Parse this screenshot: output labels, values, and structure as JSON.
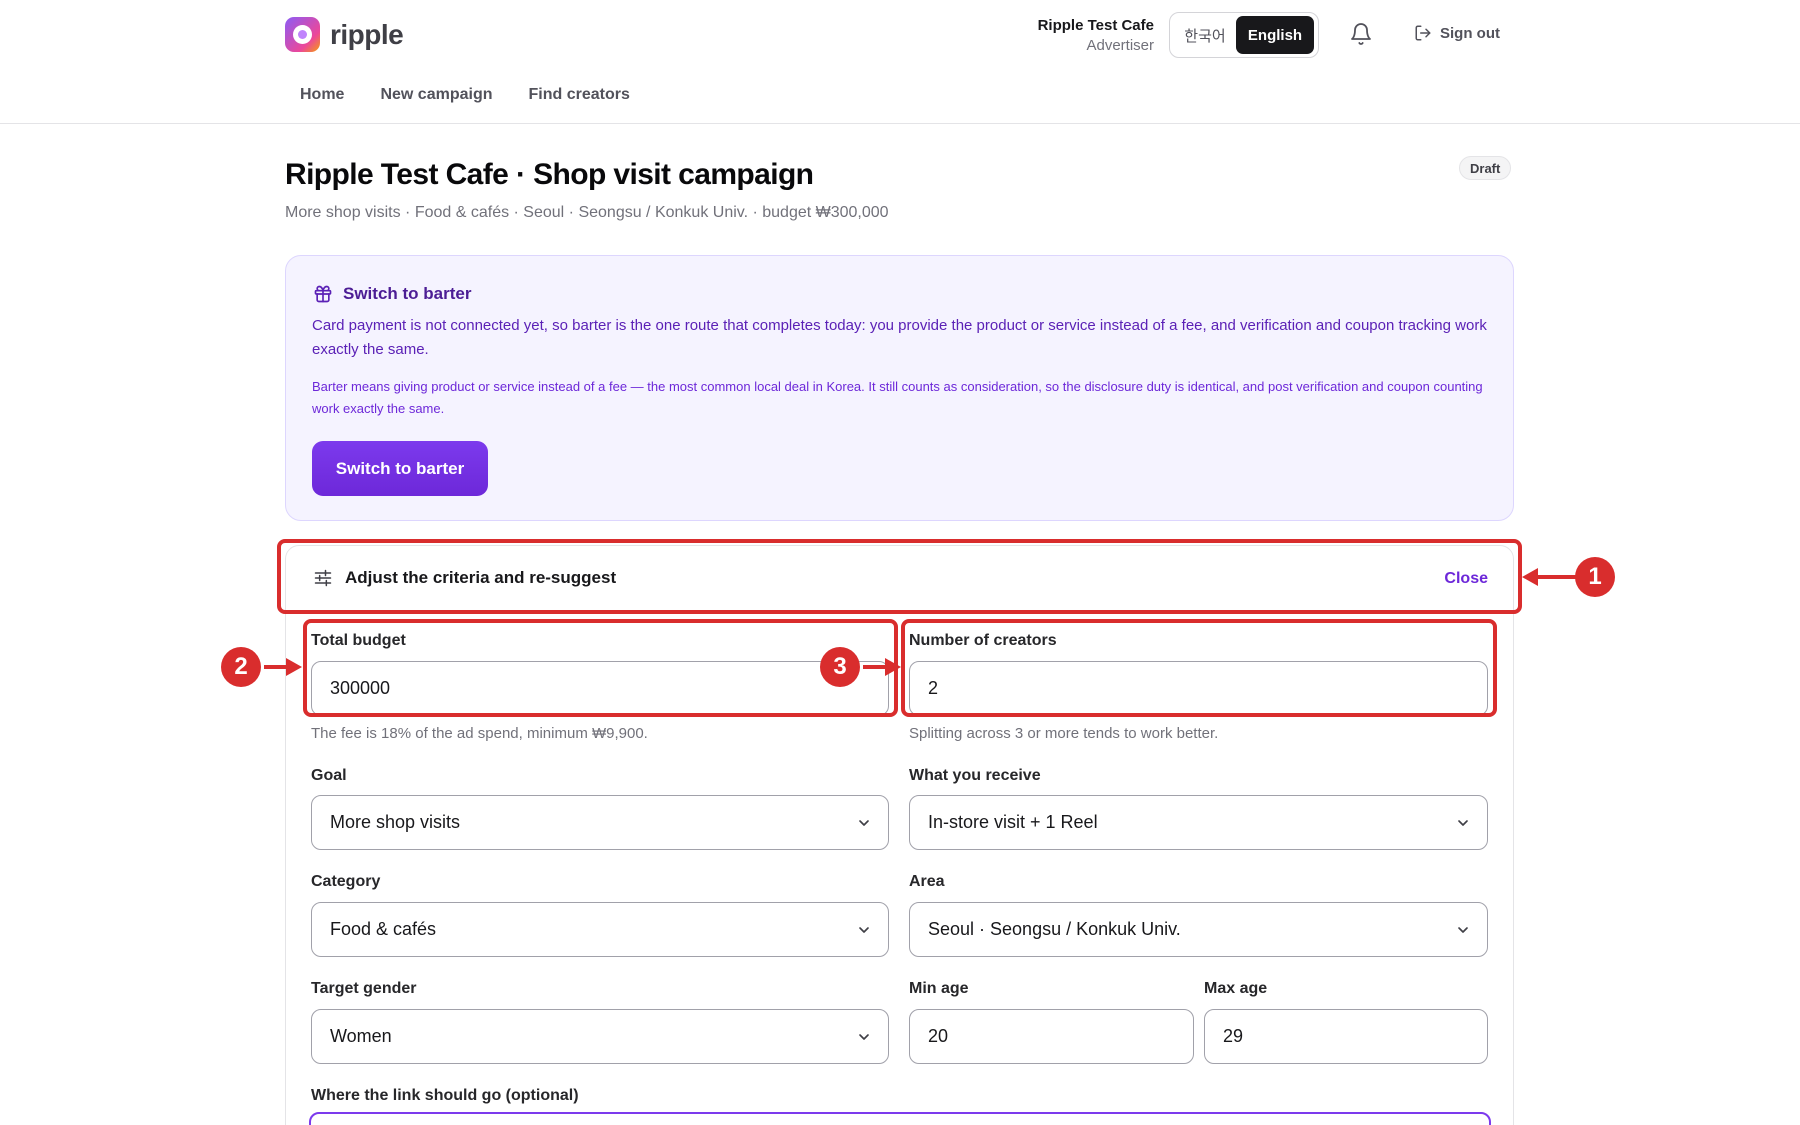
{
  "app": {
    "name": "ripple"
  },
  "user": {
    "name": "Ripple Test Cafe",
    "role": "Advertiser"
  },
  "language": {
    "korean": "한국어",
    "english": "English",
    "selected": "English"
  },
  "header": {
    "sign_out": "Sign out"
  },
  "nav": {
    "items": [
      "Home",
      "New campaign",
      "Find creators"
    ]
  },
  "page": {
    "title": "Ripple Test Cafe · Shop visit campaign",
    "subtitle": "More shop visits · Food & cafés · Seoul · Seongsu / Konkuk Univ. · budget ₩300,000",
    "status": "Draft"
  },
  "barter": {
    "title": "Switch to barter",
    "paragraph1": "Card payment is not connected yet, so barter is the one route that completes today: you provide the product or service instead of a fee, and verification and coupon tracking work exactly the same.",
    "paragraph2": "Barter means giving product or service instead of a fee — the most common local deal in Korea. It still counts as consideration, so the disclosure duty is identical, and post verification and coupon counting work exactly the same.",
    "button": "Switch to barter"
  },
  "criteria": {
    "title": "Adjust the criteria and re-suggest",
    "close": "Close",
    "total_budget": {
      "label": "Total budget",
      "value": "300000",
      "hint": "The fee is 18% of the ad spend, minimum ₩9,900."
    },
    "creators": {
      "label": "Number of creators",
      "value": "2",
      "hint": "Splitting across 3 or more tends to work better."
    },
    "goal": {
      "label": "Goal",
      "value": "More shop visits"
    },
    "receive": {
      "label": "What you receive",
      "value": "In-store visit + 1 Reel"
    },
    "category": {
      "label": "Category",
      "value": "Food & cafés"
    },
    "area": {
      "label": "Area",
      "value": "Seoul · Seongsu / Konkuk Univ."
    },
    "gender": {
      "label": "Target gender",
      "value": "Women"
    },
    "min_age": {
      "label": "Min age",
      "value": "20"
    },
    "max_age": {
      "label": "Max age",
      "value": "29"
    },
    "link": {
      "label": "Where the link should go (optional)"
    }
  },
  "annotations": {
    "marker1": "1",
    "marker2": "2",
    "marker3": "3",
    "color": "#d92d2d"
  },
  "colors": {
    "accent": "#6d28d9",
    "barter_bg": "#f5f3ff"
  }
}
